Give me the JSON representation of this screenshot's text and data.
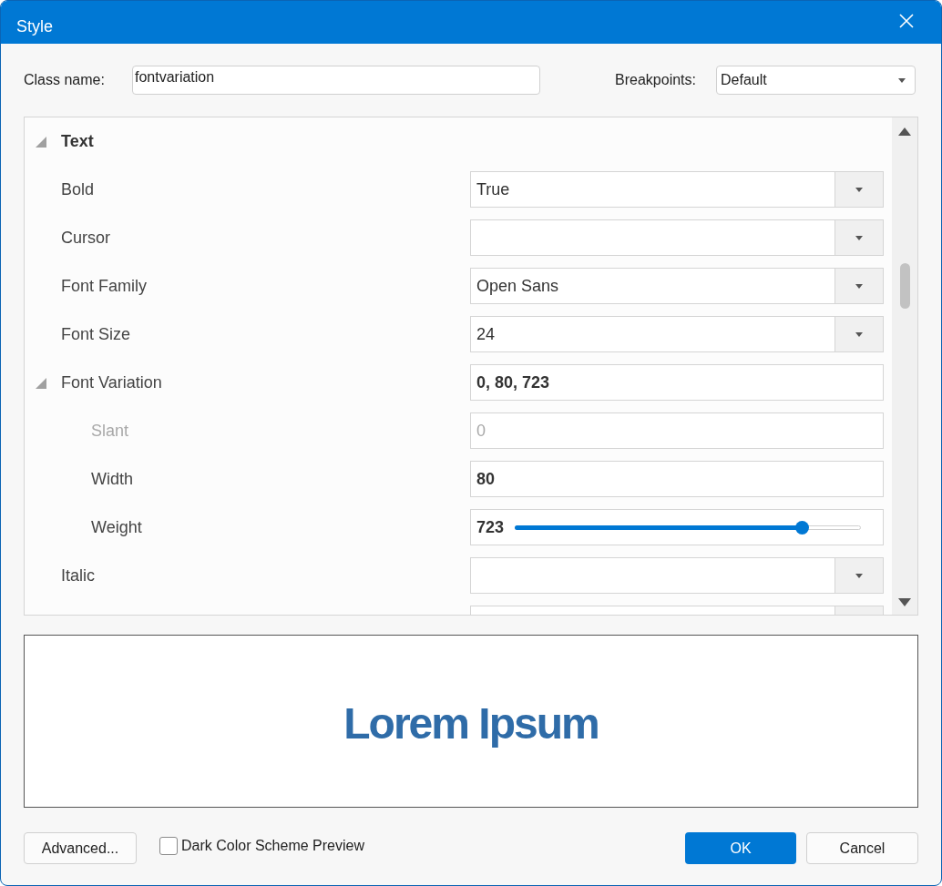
{
  "window": {
    "title": "Style"
  },
  "class_name": {
    "label": "Class name:",
    "value": "fontvariation"
  },
  "breakpoints": {
    "label": "Breakpoints:",
    "value": "Default"
  },
  "properties": [
    {
      "kind": "category",
      "label": "Text",
      "expanded": true,
      "children": [
        {
          "kind": "dropdown",
          "label": "Bold",
          "value": "True"
        },
        {
          "kind": "dropdown",
          "label": "Cursor"
        },
        {
          "kind": "dropdown",
          "label": "Font Family",
          "value": "Open Sans"
        },
        {
          "kind": "dropdown",
          "label": "Font Size",
          "value": "24"
        },
        {
          "kind": "group",
          "label": "Font Variation",
          "value": "0, 80, 723",
          "expanded": true,
          "children": [
            {
              "kind": "text",
              "label": "Slant",
              "value": "0",
              "disabled": true
            },
            {
              "kind": "text",
              "label": "Width",
              "value": "80",
              "disabled": false
            },
            {
              "kind": "slider",
              "label": "Weight",
              "value": "723",
              "level": 0.83
            }
          ]
        },
        {
          "kind": "dropdown",
          "label": "Italic"
        },
        {
          "kind": "dropdown"
        }
      ]
    }
  ],
  "preview": {
    "text": "Lorem Ipsum"
  },
  "buttons": {
    "advanced": "Advanced...",
    "ok": "OK",
    "cancel": "Cancel"
  },
  "dark_preview": {
    "label": "Dark Color Scheme Preview",
    "checked": false
  }
}
